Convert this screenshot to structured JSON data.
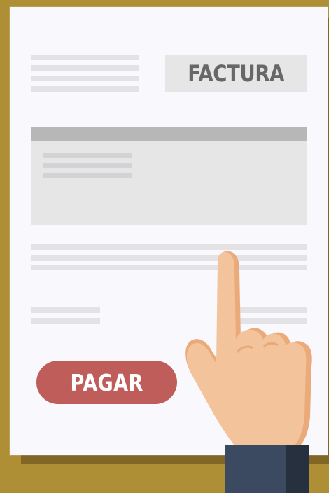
{
  "invoice": {
    "title": "FACTURA",
    "pay_button_label": "PAGAR"
  },
  "icons": [
    "pointing-hand-icon"
  ],
  "colors": {
    "background": "#ae8f36",
    "paper": "#f8f8fd",
    "pay_button": "#bf5d5a",
    "title_text": "#676767",
    "sleeve": "#3b4a60",
    "skin": "#f3c39b"
  }
}
